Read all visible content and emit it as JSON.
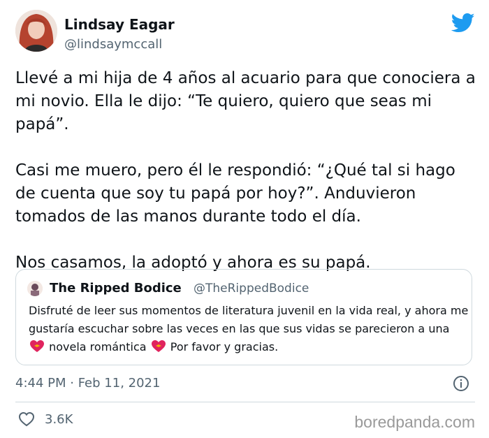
{
  "author": {
    "name": "Lindsay Eagar",
    "handle": "@lindsaymccall"
  },
  "tweet": {
    "paragraphs": [
      "Llevé a mi hija de 4 años al acuario para que conociera a mi novio. Ella le dijo: “Te quiero, quiero que seas mi papá”.",
      "Casi me muero, pero él le respondió: “¿Qué tal si hago de cuenta que soy tu papá por hoy?”. Anduvieron tomados de las manos durante todo el día.",
      "Nos casamos, la adoptó y ahora es su papá."
    ]
  },
  "quoted": {
    "name": "The Ripped Bodice",
    "handle": "@TheRippedBodice",
    "text_part1": "Disfruté de leer sus momentos de literatura juvenil en la vida real, y ahora me gustaría escuchar sobre las veces en las que sus vidas se parecieron a una",
    "text_part2": "novela romántica",
    "text_part3": "Por favor y gracias.",
    "emoji": "heart-with-ribbon"
  },
  "timestamp": "4:44 PM · Feb 11, 2021",
  "likes": "3.6K",
  "watermark": "boredpanda.com",
  "colors": {
    "brand_blue": "#1d9bf0",
    "secondary_text": "#536471",
    "border": "#cfd9de"
  }
}
